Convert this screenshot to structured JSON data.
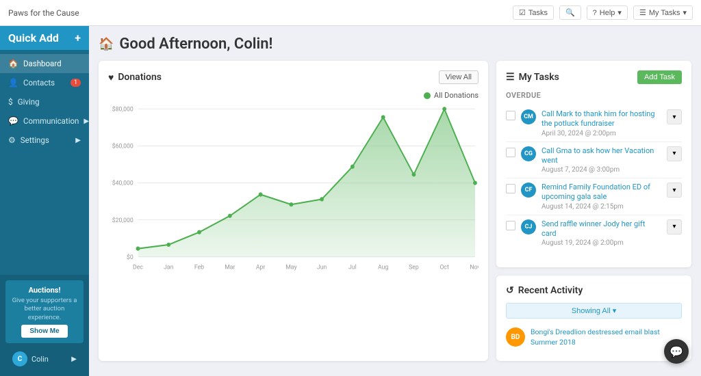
{
  "topbar": {
    "brand": "Paws for the Cause",
    "tasks_label": "Tasks",
    "search_label": "🔍",
    "help_label": "Help",
    "my_tasks_label": "My Tasks"
  },
  "sidebar": {
    "quick_add_label": "Quick Add",
    "quick_add_icon": "+",
    "nav_items": [
      {
        "id": "dashboard",
        "label": "Dashboard",
        "icon": "🏠",
        "active": true
      },
      {
        "id": "contacts",
        "label": "Contacts",
        "icon": "👤",
        "badge": "1"
      },
      {
        "id": "giving",
        "label": "Giving",
        "icon": "$"
      },
      {
        "id": "communication",
        "label": "Communication",
        "icon": "💬",
        "arrow": "▶"
      },
      {
        "id": "settings",
        "label": "Settings",
        "icon": "⚙",
        "arrow": "▶"
      }
    ],
    "auction": {
      "title": "Auctions!",
      "description": "Give your supporters a better auction experience.",
      "button_label": "Show Me"
    },
    "user": {
      "name": "Colin",
      "initials": "C"
    }
  },
  "greeting": {
    "text": "Good Afternoon, Colin!"
  },
  "donations_card": {
    "title": "Donations",
    "icon": "♥",
    "view_all_label": "View All",
    "legend_label": "All Donations",
    "chart": {
      "y_labels": [
        "$80,000",
        "$60,000",
        "$40,000",
        "$20,000",
        "$0"
      ],
      "x_labels": [
        "Dec",
        "Jan",
        "Feb",
        "Mar",
        "Apr",
        "May",
        "Jun",
        "Jul",
        "Aug",
        "Sep",
        "Oct",
        "Nov"
      ],
      "data_points": [
        5,
        8,
        15,
        25,
        38,
        32,
        35,
        55,
        85,
        50,
        90,
        45
      ]
    }
  },
  "tasks_card": {
    "title": "My Tasks",
    "icon": "☰",
    "add_task_label": "Add Task",
    "overdue_label": "Overdue",
    "tasks": [
      {
        "id": 1,
        "title": "Call Mark to thank him for hosting the potluck fundraiser",
        "date": "April 30, 2024 @ 2:00pm",
        "initials": "CM"
      },
      {
        "id": 2,
        "title": "Call Gma to ask how her Vacation went",
        "date": "August 7, 2024 @ 3:00pm",
        "initials": "CG"
      },
      {
        "id": 3,
        "title": "Remind Family Foundation ED of upcoming gala sale",
        "date": "August 14, 2024 @ 2:15pm",
        "initials": "CF"
      },
      {
        "id": 4,
        "title": "Send raffle winner Jody her gift card",
        "date": "August 19, 2024 @ 2:00pm",
        "initials": "CJ"
      }
    ]
  },
  "recent_activity": {
    "title": "Recent Activity",
    "icon": "↺",
    "showing_all_label": "Showing All ▾",
    "items": [
      {
        "id": 1,
        "text": "Bongi's Dreadlion destressed email blast Summer 2018",
        "initials": "BD"
      }
    ]
  }
}
